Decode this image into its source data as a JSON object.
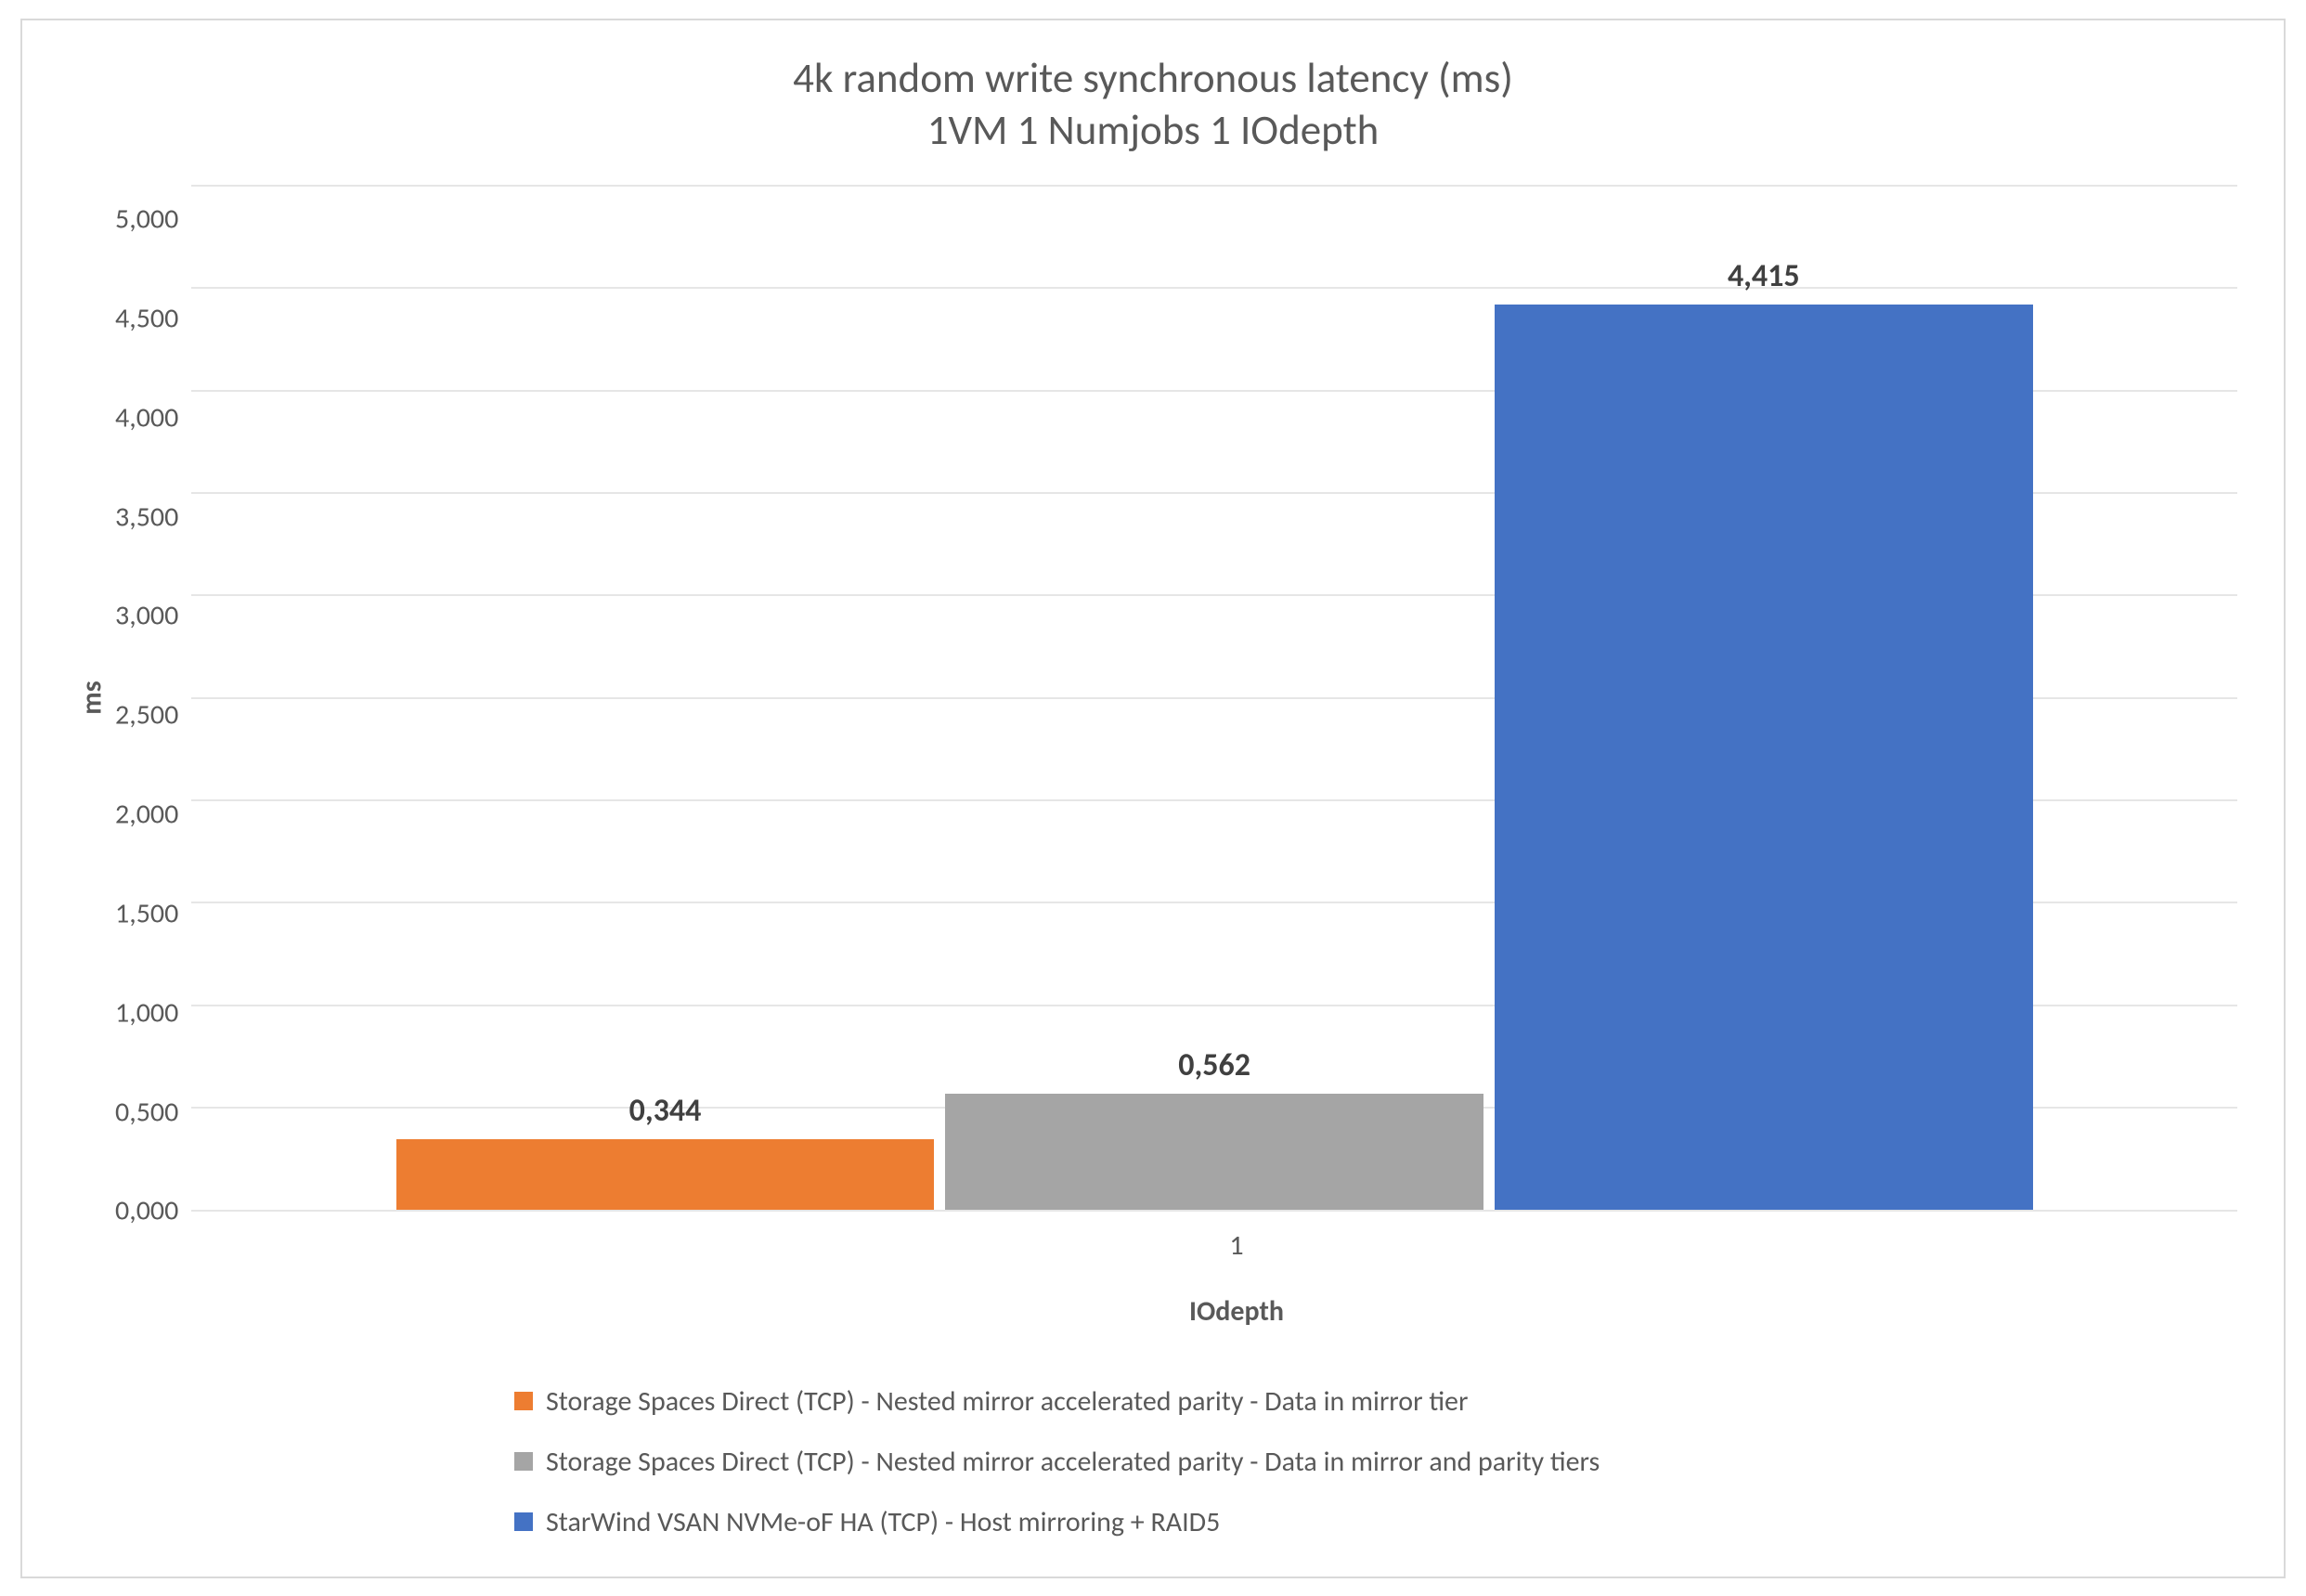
{
  "chart_data": {
    "type": "bar",
    "title_line1": "4k random write synchronous latency (ms)",
    "title_line2": "1VM 1 Numjobs 1 IOdepth",
    "xlabel": "IOdepth",
    "ylabel": "ms",
    "categories": [
      "1"
    ],
    "ylim": [
      0,
      5
    ],
    "ytick_labels": [
      "5,000",
      "4,500",
      "4,000",
      "3,500",
      "3,000",
      "2,500",
      "2,000",
      "1,500",
      "1,000",
      "0,500",
      "0,000"
    ],
    "series": [
      {
        "name": "Storage Spaces Direct (TCP) - Nested mirror accelerated parity - Data in mirror tier",
        "color": "#ED7D31",
        "values": [
          0.344
        ],
        "value_labels": [
          "0,344"
        ]
      },
      {
        "name": "Storage Spaces Direct (TCP) - Nested mirror accelerated parity - Data in mirror and parity tiers",
        "color": "#A5A5A5",
        "values": [
          0.562
        ],
        "value_labels": [
          "0,562"
        ]
      },
      {
        "name": "StarWind VSAN NVMe-oF HA (TCP) - Host mirroring + RAID5",
        "color": "#4472C4",
        "values": [
          4.415
        ],
        "value_labels": [
          "4,415"
        ]
      }
    ]
  }
}
